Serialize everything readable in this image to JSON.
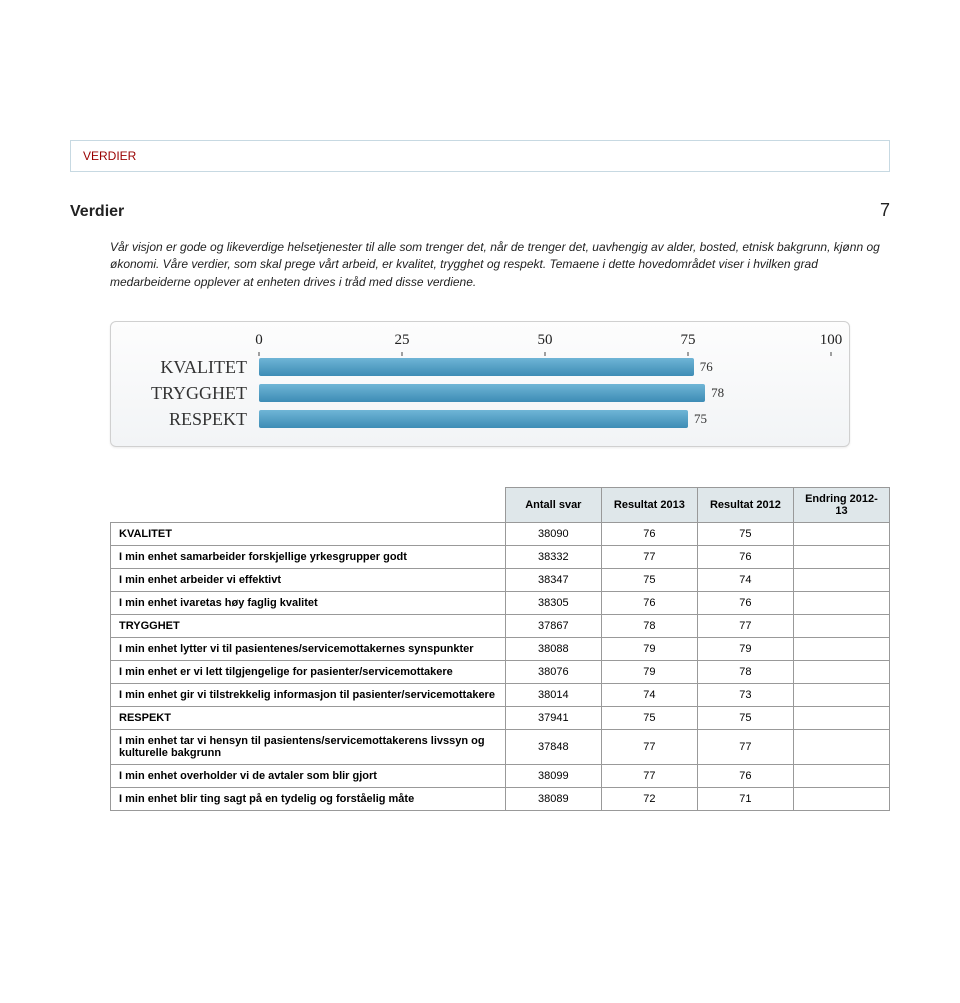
{
  "breadcrumb": "VERDIER",
  "section_title": "Verdier",
  "page_number": "7",
  "intro_text": "Vår visjon er gode og likeverdige helsetjenester til alle som trenger det, når de trenger det, uavhengig av alder, bosted, etnisk bakgrunn, kjønn og økonomi. Våre verdier, som skal prege vårt arbeid, er kvalitet, trygghet og respekt. Temaene i dette hovedområdet viser i hvilken grad medarbeiderne opplever at enheten drives i tråd med disse verdiene.",
  "chart_data": {
    "type": "bar",
    "xmin": 0,
    "xmax": 100,
    "ticks": [
      0,
      25,
      50,
      75,
      100
    ],
    "series": [
      {
        "name": "KVALITET",
        "value": 76
      },
      {
        "name": "TRYGGHET",
        "value": 78
      },
      {
        "name": "RESPEKT",
        "value": 75
      }
    ],
    "title": "",
    "xlabel": "",
    "ylabel": ""
  },
  "table": {
    "headers": [
      "Antall svar",
      "Resultat 2013",
      "Resultat 2012",
      "Endring 2012-13"
    ],
    "rows": [
      {
        "label": "KVALITET",
        "cells": [
          "38090",
          "76",
          "75",
          ""
        ],
        "cat": true
      },
      {
        "label": "I min enhet samarbeider forskjellige yrkesgrupper godt",
        "cells": [
          "38332",
          "77",
          "76",
          ""
        ]
      },
      {
        "label": "I min enhet arbeider vi effektivt",
        "cells": [
          "38347",
          "75",
          "74",
          ""
        ]
      },
      {
        "label": "I min enhet ivaretas høy faglig kvalitet",
        "cells": [
          "38305",
          "76",
          "76",
          ""
        ]
      },
      {
        "label": "TRYGGHET",
        "cells": [
          "37867",
          "78",
          "77",
          ""
        ],
        "cat": true
      },
      {
        "label": "I min enhet lytter vi til pasientenes/servicemottakernes synspunkter",
        "cells": [
          "38088",
          "79",
          "79",
          ""
        ]
      },
      {
        "label": "I min enhet er vi lett tilgjengelige for pasienter/servicemottakere",
        "cells": [
          "38076",
          "79",
          "78",
          ""
        ]
      },
      {
        "label": "I min enhet gir vi tilstrekkelig informasjon til pasienter/servicemottakere",
        "cells": [
          "38014",
          "74",
          "73",
          ""
        ]
      },
      {
        "label": "RESPEKT",
        "cells": [
          "37941",
          "75",
          "75",
          ""
        ],
        "cat": true
      },
      {
        "label": "I min enhet tar vi hensyn til pasientens/servicemottakerens livssyn og kulturelle bakgrunn",
        "cells": [
          "37848",
          "77",
          "77",
          ""
        ]
      },
      {
        "label": "I min enhet overholder vi de avtaler som blir gjort",
        "cells": [
          "38099",
          "77",
          "76",
          ""
        ]
      },
      {
        "label": "I min enhet blir ting sagt på en tydelig og forståelig måte",
        "cells": [
          "38089",
          "72",
          "71",
          ""
        ]
      }
    ]
  }
}
